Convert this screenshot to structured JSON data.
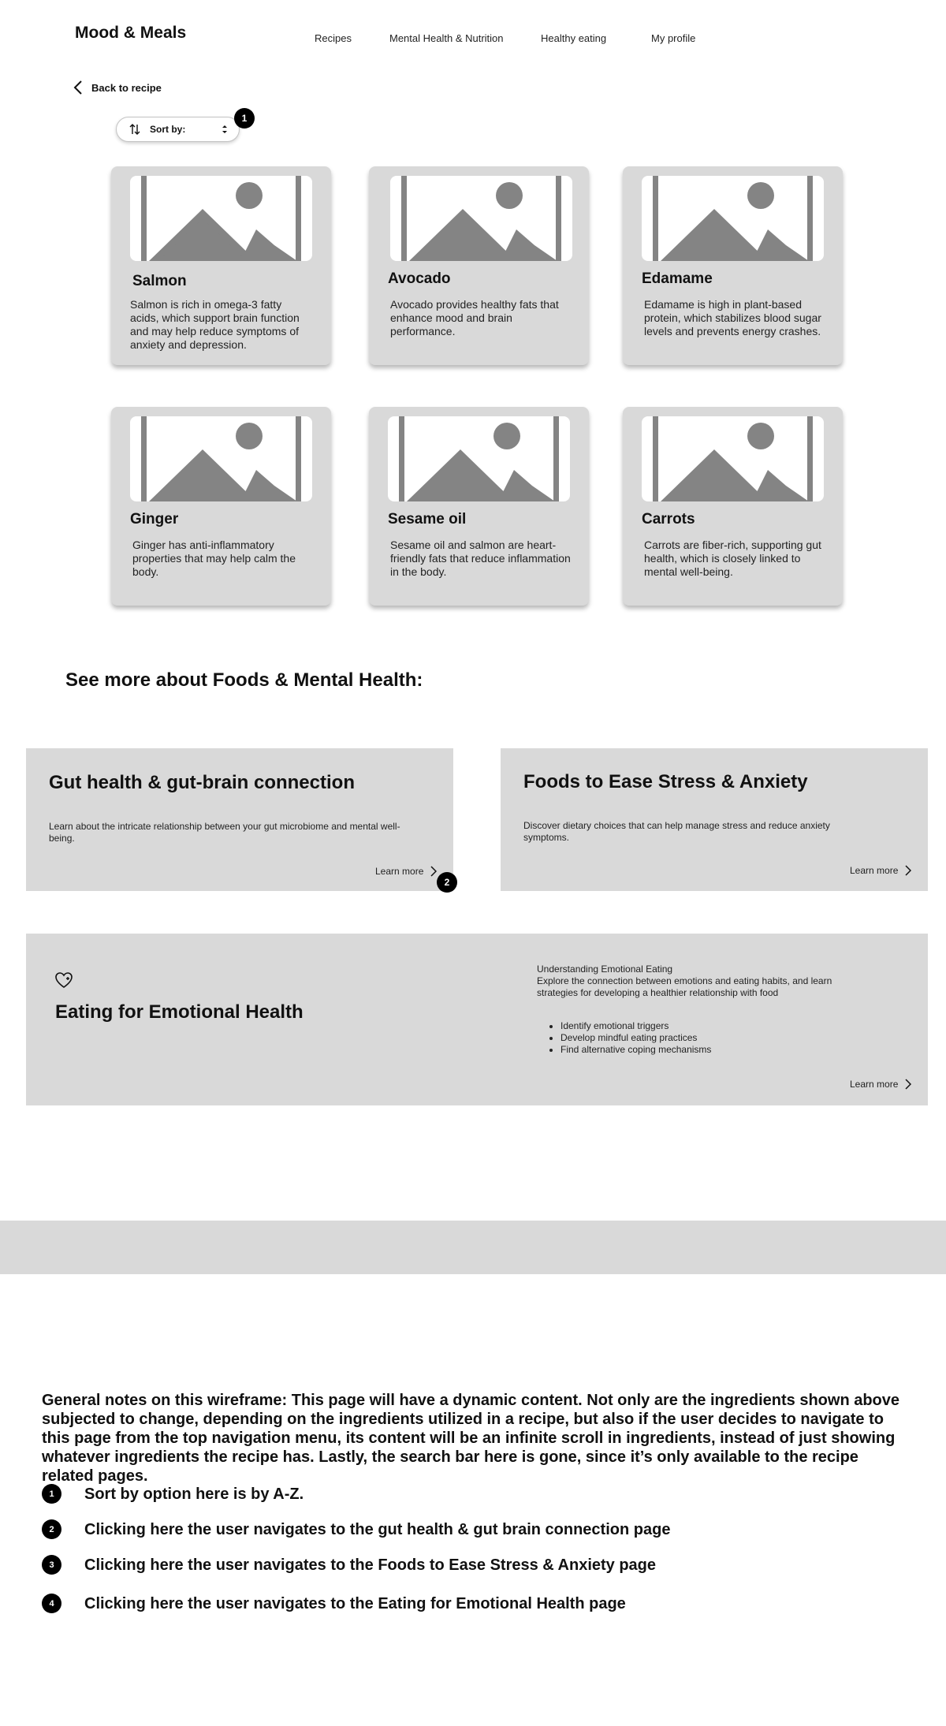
{
  "header": {
    "brand": "Mood & Meals",
    "nav": [
      "Recipes",
      "Mental Health & Nutrition",
      "Healthy eating",
      "My profile"
    ]
  },
  "back": {
    "label": "Back to recipe"
  },
  "sort": {
    "label": "Sort by:"
  },
  "markers": [
    "1",
    "2",
    "3",
    "4"
  ],
  "cards": [
    {
      "name": "Salmon",
      "description": "Salmon is rich in omega-3 fatty acids, which support brain function and may help reduce symptoms of anxiety and depression."
    },
    {
      "name": "Avocado",
      "description": "Avocado provides healthy fats that enhance mood and brain performance."
    },
    {
      "name": "Edamame",
      "description": "Edamame is high in plant-based protein, which stabilizes blood sugar levels and prevents energy crashes."
    },
    {
      "name": "Ginger",
      "description": "Ginger has anti-inflammatory properties that may help calm the body."
    },
    {
      "name": "Sesame oil",
      "description": "Sesame oil and salmon are heart-friendly fats that reduce inflammation in the body."
    },
    {
      "name": "Carrots",
      "description": "Carrots are fiber-rich, supporting gut health, which is closely linked to mental well-being."
    }
  ],
  "more_section": {
    "title": "See more about Foods & Mental Health:"
  },
  "topics": [
    {
      "title": "Gut health & gut-brain connection",
      "description": "Learn about the intricate relationship between your gut microbiome and mental well-being.",
      "link": "Learn more"
    },
    {
      "title": "Foods to Ease Stress & Anxiety",
      "description": "Discover dietary choices that can help manage stress and reduce anxiety symptoms.",
      "link": "Learn more"
    }
  ],
  "emotional": {
    "title": "Eating for Emotional Health",
    "heading": "Understanding Emotional Eating",
    "intro": "Explore the connection between emotions and eating habits, and learn strategies for developing a healthier relationship with food",
    "bullets": [
      "Identify emotional triggers",
      "Develop mindful eating practices",
      "Find alternative coping mechanisms"
    ],
    "link": "Learn more"
  },
  "notes": {
    "general": "General notes on this wireframe: This page will have a dynamic content. Not only are the ingredients shown above subjected to change, depending on the ingredients utilized in a recipe, but also if the user decides to navigate to this page from the top navigation menu, its content will be an infinite scroll in ingredients, instead of just showing whatever ingredients the recipe has. Lastly, the search bar here is gone, since it’s only available to the recipe related pages.",
    "items": [
      "Sort by option here is by A-Z.",
      "Clicking here the user navigates to the gut health & gut brain connection page",
      "Clicking here the user navigates to the Foods to Ease Stress & Anxiety page",
      "Clicking here the user navigates to the Eating for Emotional Health page"
    ]
  }
}
